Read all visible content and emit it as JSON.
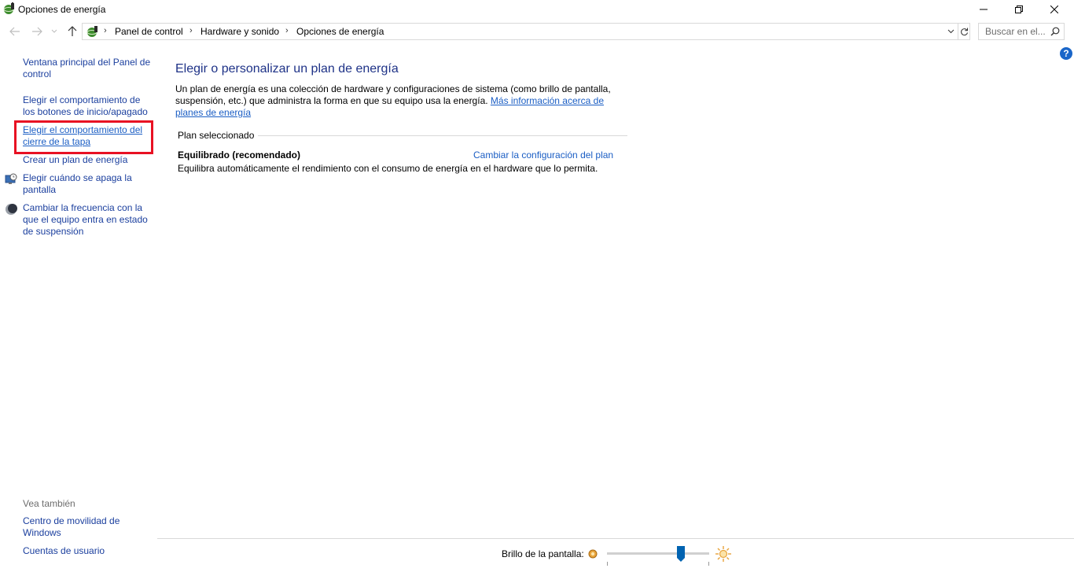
{
  "window": {
    "title": "Opciones de energía",
    "controls": [
      "minimize",
      "restore",
      "close"
    ]
  },
  "address_bar": {
    "breadcrumbs": [
      "Panel de control",
      "Hardware y sonido",
      "Opciones de energía"
    ],
    "search_placeholder": "Buscar en el..."
  },
  "left_pane": {
    "home_link": "Ventana principal del Panel de control",
    "links": [
      {
        "label": "Elegir el comportamiento de los botones de inicio/apagado",
        "icon": null
      },
      {
        "label": "Elegir el comportamiento del cierre de la tapa",
        "icon": null,
        "highlighted": true
      },
      {
        "label": "Crear un plan de energía",
        "icon": null
      },
      {
        "label": "Elegir cuándo se apaga la pantalla",
        "icon": "monitor-clock-icon"
      },
      {
        "label": "Cambiar la frecuencia con la que el equipo entra en estado de suspensión",
        "icon": "moon-icon"
      }
    ],
    "see_also_label": "Vea también",
    "see_also_links": [
      "Centro de movilidad de Windows",
      "Cuentas de usuario"
    ]
  },
  "main": {
    "title": "Elegir o personalizar un plan de energía",
    "description": "Un plan de energía es una colección de hardware y configuraciones de sistema (como brillo de pantalla, suspensión, etc.) que administra la forma en que su equipo usa la energía.",
    "more_info_link": "Más información acerca de planes de energía",
    "selected_plan_label": "Plan seleccionado",
    "plan": {
      "name": "Equilibrado (recomendado)",
      "change_link": "Cambiar la configuración del plan",
      "description": "Equilibra automáticamente el rendimiento con el consumo de energía en el hardware que lo permita."
    }
  },
  "footer": {
    "brightness_label": "Brillo de la pantalla:",
    "brightness_level": 0.72
  },
  "colors": {
    "link": "#1b3f9e",
    "title": "#1e3287",
    "highlight": "#e81123",
    "accent": "#0063b1"
  }
}
